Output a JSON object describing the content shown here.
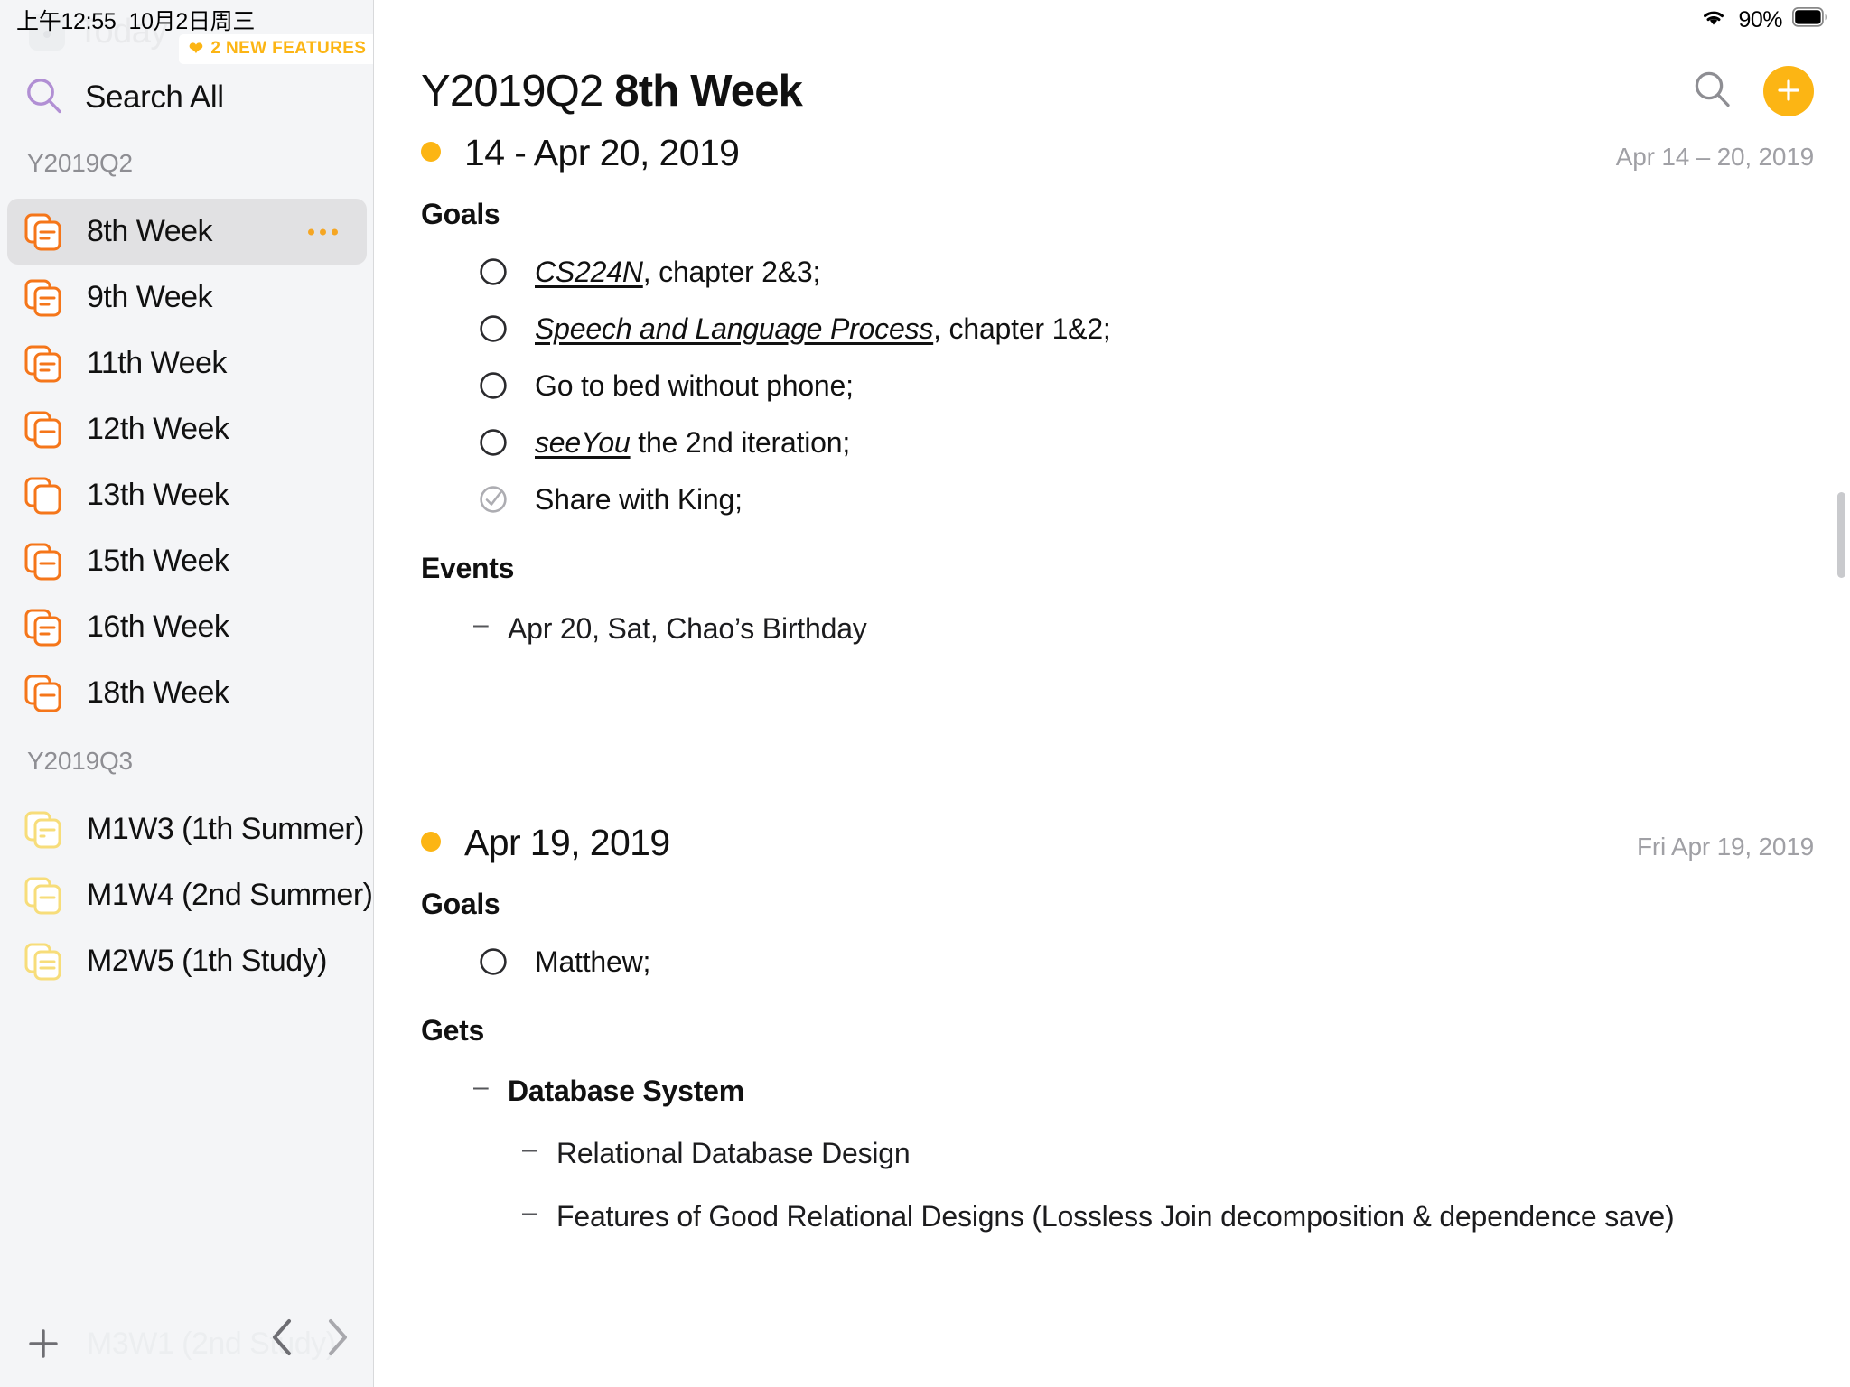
{
  "status_bar": {
    "time": "上午12:55",
    "date": "10月2日周三",
    "wifi_icon": "wifi-icon",
    "battery_percent": "90%",
    "battery_icon": "battery-icon"
  },
  "sidebar": {
    "today_ghost_label": "Today",
    "features_badge": {
      "heart_icon": "heart-icon",
      "label": "2 NEW FEATURES"
    },
    "search": {
      "icon": "search-icon",
      "label": "Search All"
    },
    "sections": [
      {
        "label": "Y2019Q2",
        "icon_color": "#f5761a",
        "items": [
          {
            "label": "8th Week",
            "icon": "stacked-doc-icon",
            "lines": 2,
            "selected": true,
            "more_icon": "more-options-icon"
          },
          {
            "label": "9th Week",
            "icon": "stacked-doc-icon",
            "lines": 2,
            "selected": false
          },
          {
            "label": "11th Week",
            "icon": "stacked-doc-icon",
            "lines": 2,
            "selected": false
          },
          {
            "label": "12th Week",
            "icon": "stacked-doc-icon",
            "lines": 1,
            "selected": false
          },
          {
            "label": "13th Week",
            "icon": "stacked-doc-icon",
            "lines": 0,
            "selected": false
          },
          {
            "label": "15th Week",
            "icon": "stacked-doc-icon",
            "lines": 1,
            "selected": false
          },
          {
            "label": "16th Week",
            "icon": "stacked-doc-icon",
            "lines": 2,
            "selected": false
          },
          {
            "label": "18th Week",
            "icon": "stacked-doc-icon",
            "lines": 1,
            "selected": false
          }
        ]
      },
      {
        "label": "Y2019Q3",
        "icon_color": "#f7dd7a",
        "items": [
          {
            "label": "M1W3 (1th Summer)",
            "icon": "stacked-doc-icon",
            "lines": 2,
            "selected": false
          },
          {
            "label": "M1W4 (2nd Summer)",
            "icon": "stacked-doc-icon",
            "lines": 1,
            "selected": false
          },
          {
            "label": "M2W5 (1th Study)",
            "icon": "stacked-doc-icon",
            "lines": 2,
            "selected": false
          }
        ]
      }
    ],
    "add_row": {
      "icon": "plus-icon",
      "label": "M3W1 (2nd Study)"
    },
    "pager": {
      "prev_icon": "chevron-left-icon",
      "next_icon": "chevron-right-icon"
    },
    "scrollbar": "sidebar-scrollbar"
  },
  "main": {
    "header": {
      "title_quarter": "Y2019Q2",
      "title_week": "8th Week",
      "search_icon": "search-icon",
      "add_icon": "plus-icon"
    },
    "entries": [
      {
        "date_title": "14 - Apr 20, 2019",
        "date_range": "Apr 14 – 20, 2019",
        "goals_heading": "Goals",
        "goals": [
          {
            "checked": false,
            "ref": "CS224N",
            "rest": ", chapter 2&3;"
          },
          {
            "checked": false,
            "ref": "Speech and Language Process",
            "rest": ", chapter 1&2;"
          },
          {
            "checked": false,
            "ref": "",
            "rest": "Go to bed without phone;"
          },
          {
            "checked": false,
            "ref": "seeYou",
            "rest": " the 2nd iteration;"
          },
          {
            "checked": true,
            "ref": "",
            "rest": "Share with King;"
          }
        ],
        "events_heading": "Events",
        "events": [
          {
            "mark": "–",
            "text": "Apr 20, Sat, Chao’s Birthday"
          }
        ]
      },
      {
        "date_title": "Apr 19, 2019",
        "date_range": "Fri Apr 19, 2019",
        "goals_heading": "Goals",
        "goals": [
          {
            "checked": false,
            "ref": "",
            "rest": "Matthew;"
          }
        ],
        "gets_heading": "Gets",
        "gets": [
          {
            "mark": "–",
            "level": 1,
            "bold": true,
            "text": "Database System"
          },
          {
            "mark": "–",
            "level": 2,
            "bold": false,
            "text": "Relational Database Design"
          },
          {
            "mark": "–",
            "level": 2,
            "bold": false,
            "text": "Features of Good Relational Designs (Lossless Join decomposition & dependence save)"
          }
        ]
      }
    ],
    "scrollbar": "main-scrollbar"
  },
  "colors": {
    "accent_orange": "#fcb514",
    "icon_orange": "#f5761a",
    "icon_yellow": "#f7dd7a",
    "sidebar_bg": "#f4f5f7",
    "selected_row": "#e1e1e3"
  }
}
